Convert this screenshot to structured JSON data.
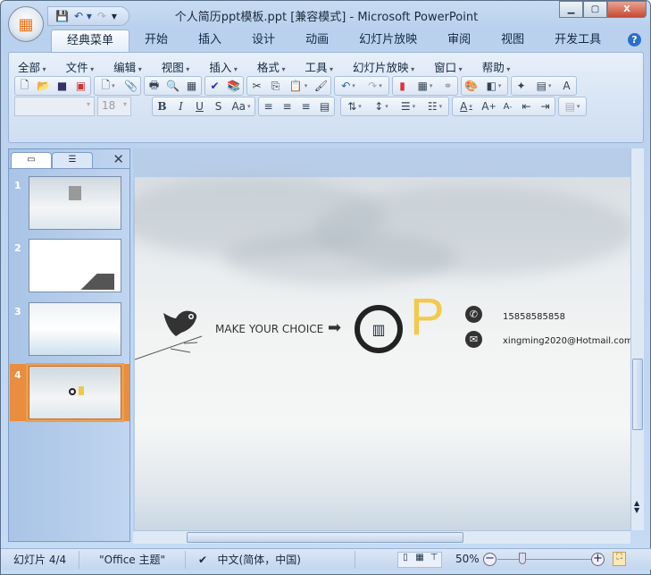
{
  "window": {
    "title": "个人简历ppt模板.ppt [兼容模式] - Microsoft PowerPoint",
    "minimize": "▁",
    "restore": "▢",
    "close": "X"
  },
  "qat": {
    "save": "💾",
    "undo": "↶ ▾",
    "redo": "↷",
    "customize": "▾"
  },
  "tabs": [
    "经典菜单",
    "开始",
    "插入",
    "设计",
    "动画",
    "幻灯片放映",
    "审阅",
    "视图",
    "开发工具"
  ],
  "help": "?",
  "menu": [
    "全部",
    "文件",
    "编辑",
    "视图",
    "插入",
    "格式",
    "工具",
    "幻灯片放映",
    "窗口",
    "帮助"
  ],
  "toolbar1": [
    [
      "new-doc",
      "📄"
    ],
    [
      "open-folder",
      "📂"
    ],
    [
      "save",
      "💾"
    ],
    [
      "publish",
      "🖼"
    ]
  ],
  "font": {
    "name": "",
    "size": "18"
  },
  "format_buttons": [
    "B",
    "I",
    "U",
    "S",
    "Aa"
  ],
  "align_buttons": [
    "≡",
    "≡",
    "≡",
    "▤"
  ],
  "left_panel": {
    "tab_slides": "▭",
    "tab_outline": "☰",
    "close": "✕",
    "slides": [
      "1",
      "2",
      "3",
      "4"
    ],
    "selected": 4
  },
  "slide": {
    "tagline": "MAKE YOUR  CHOICE",
    "arrow": "➡",
    "logo_letter": "P",
    "phone": "15858585858",
    "email": "xingming2020@Hotmail.com"
  },
  "status": {
    "slide": "幻灯片 4/4",
    "theme": "\"Office 主题\"",
    "language": "中文(简体，中国)",
    "zoom": "50%",
    "zoom_percent": 50
  }
}
